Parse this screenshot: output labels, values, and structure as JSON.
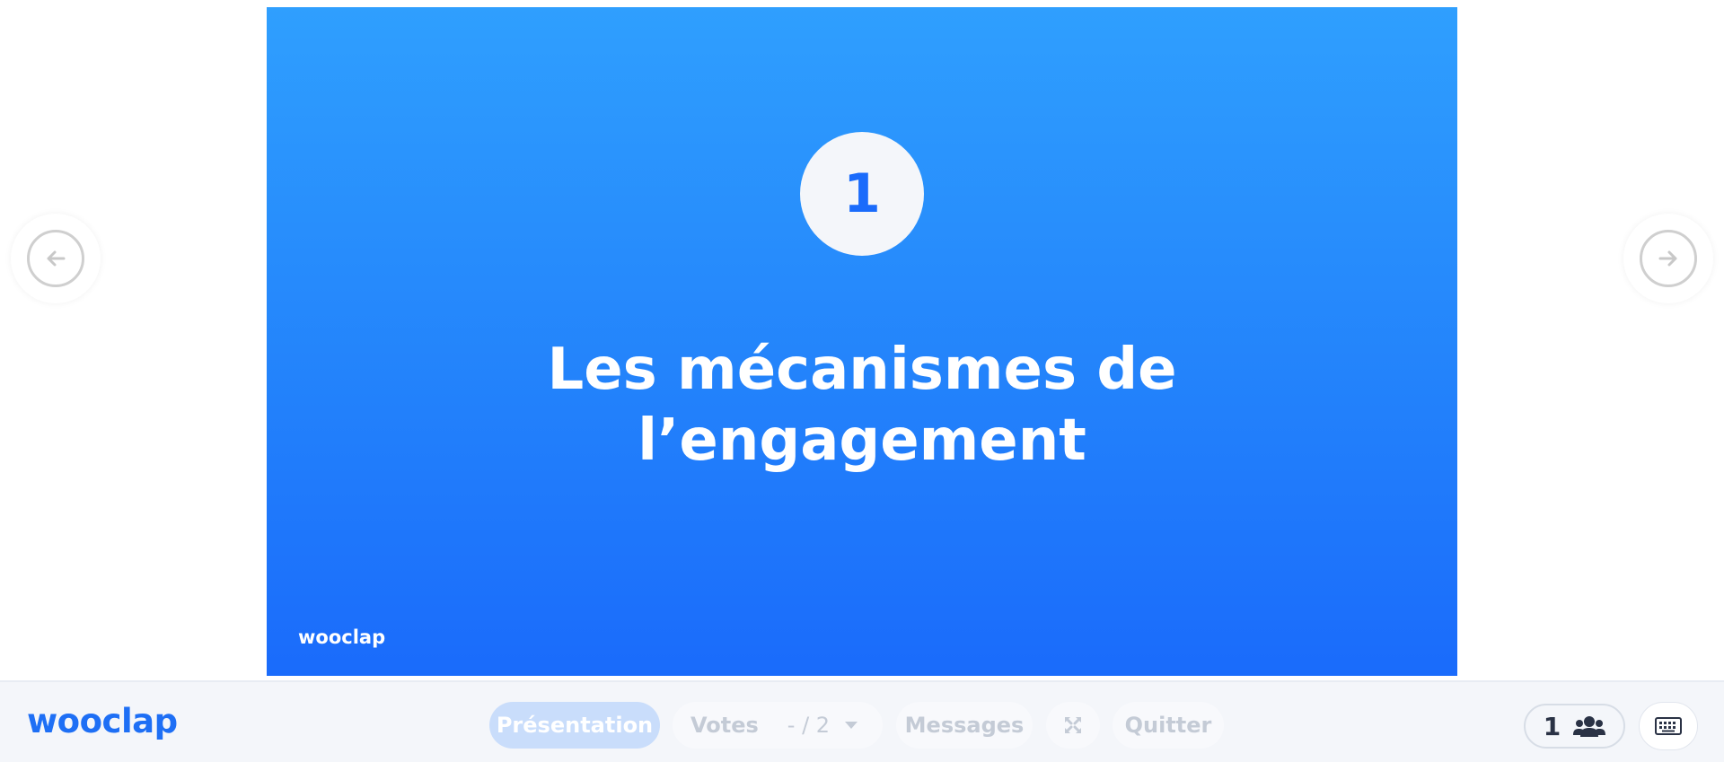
{
  "slide": {
    "number": "1",
    "title_line1": "Les mécanismes de",
    "title_line2": "l’engagement",
    "logo": "wooclap"
  },
  "toolbar": {
    "brand": "wooclap",
    "presentation_label": "Présentation",
    "votes_label": "Votes",
    "votes_counter": "-   / 2",
    "messages_label": "Messages",
    "quit_label": "Quitter",
    "participants_count": "1"
  },
  "icons": {
    "prev": "arrow-left-icon",
    "next": "arrow-right-icon",
    "votes_dropdown": "caret-down-icon",
    "fullscreen": "expand-icon",
    "participants": "users-icon",
    "keyboard": "keyboard-icon"
  },
  "colors": {
    "slide_top": "#2f9ffe",
    "slide_bottom": "#1a6bfb",
    "brand": "#1e6ff5",
    "active_pill": "#c9ddfb"
  }
}
